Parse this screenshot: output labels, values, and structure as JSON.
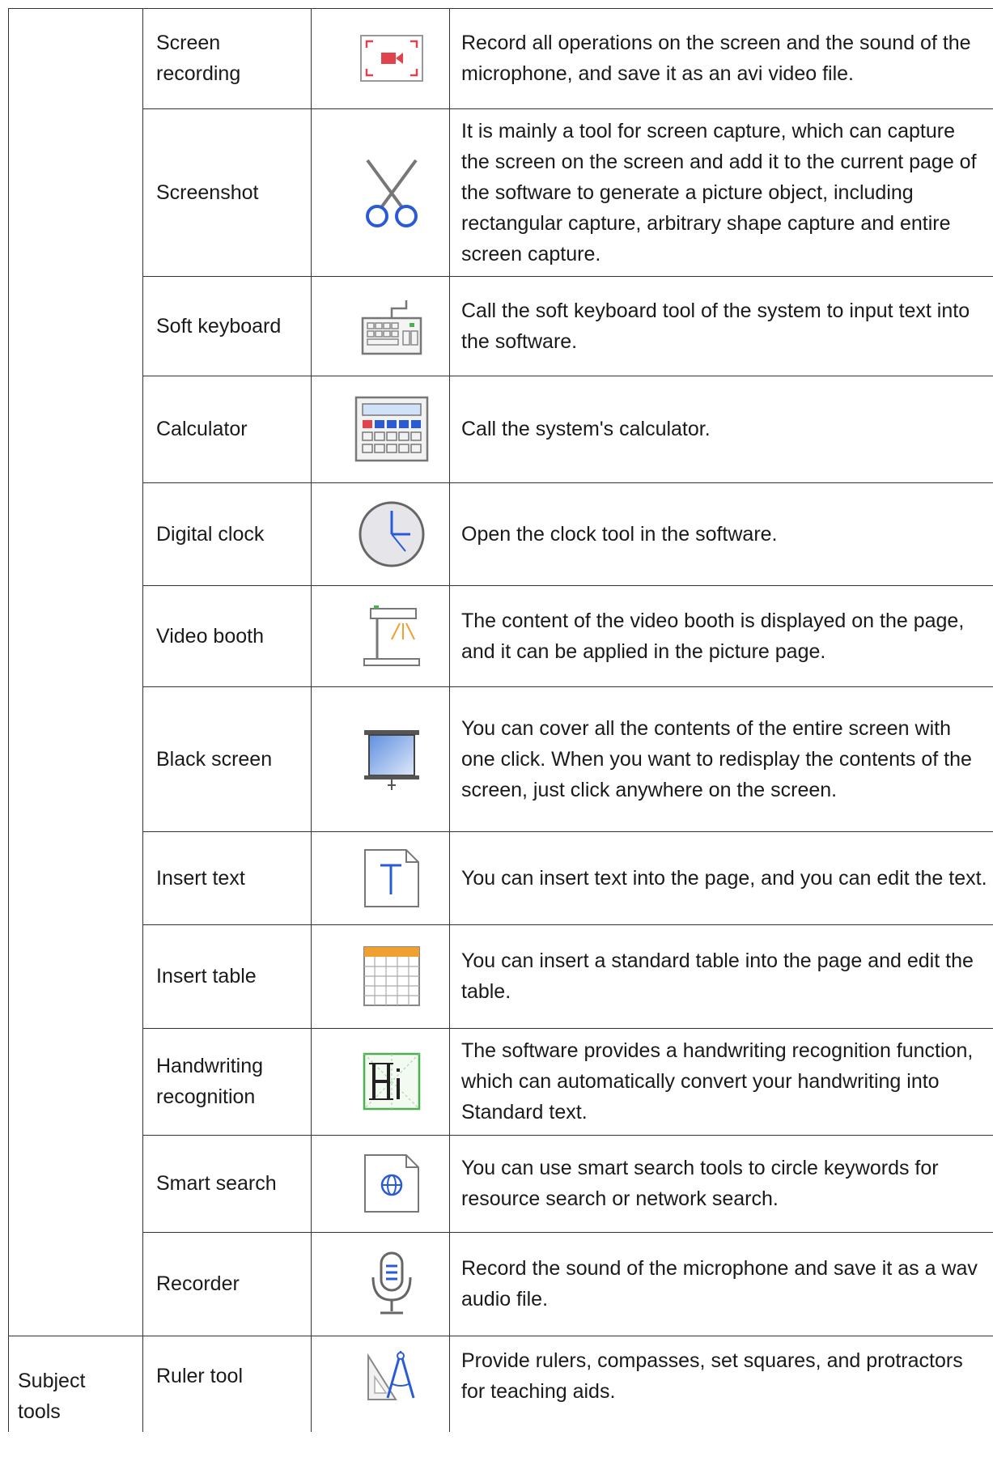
{
  "rows": [
    {
      "name": "Screen\nrecording",
      "icon": "screen-recording-icon",
      "description": "Record all operations on the screen and the sound of the microphone, and save it as an avi video file."
    },
    {
      "name": "Screenshot",
      "icon": "scissors-icon",
      "description": "It is mainly a tool for screen capture, which can capture the screen on the screen and add it to the current page of the software to generate a picture object, including rectangular capture, arbitrary shape capture and entire screen capture."
    },
    {
      "name": "Soft keyboard",
      "icon": "keyboard-icon",
      "description": "Call the soft keyboard tool of the system to input text into the software."
    },
    {
      "name": "Calculator",
      "icon": "calculator-icon",
      "description": "Call the system's calculator."
    },
    {
      "name": "Digital clock",
      "icon": "clock-icon",
      "description": "Open the clock tool in the software."
    },
    {
      "name": "Video booth",
      "icon": "video-booth-icon",
      "description": "The content of the video booth is displayed on the page, and it can be applied in the picture page."
    },
    {
      "name": "Black screen",
      "icon": "projector-screen-icon",
      "description": "You can cover all the contents of the entire screen with one click. When you want to redisplay the contents of the screen, just click anywhere on the screen."
    },
    {
      "name": "Insert text",
      "icon": "text-document-icon",
      "description": "You can insert text into the page, and you can edit the text."
    },
    {
      "name": "Insert table",
      "icon": "table-icon",
      "description": "You can insert a standard table into the page and edit the table."
    },
    {
      "name": "Handwriting\nrecognition",
      "icon": "handwriting-icon",
      "description": "The software provides a handwriting recognition function, which can automatically convert your handwriting into Standard text."
    },
    {
      "name": "Smart search",
      "icon": "globe-search-icon",
      "description": "You can use smart search tools to circle keywords for resource search or network search."
    },
    {
      "name": "Recorder",
      "icon": "microphone-icon",
      "description": "Record the sound of the microphone and save it as a wav audio file."
    },
    {
      "category": "Subject\ntools",
      "name": "Ruler tool",
      "icon": "ruler-compass-icon",
      "description": "Provide rulers, compasses, set squares, and protractors for teaching aids."
    }
  ]
}
